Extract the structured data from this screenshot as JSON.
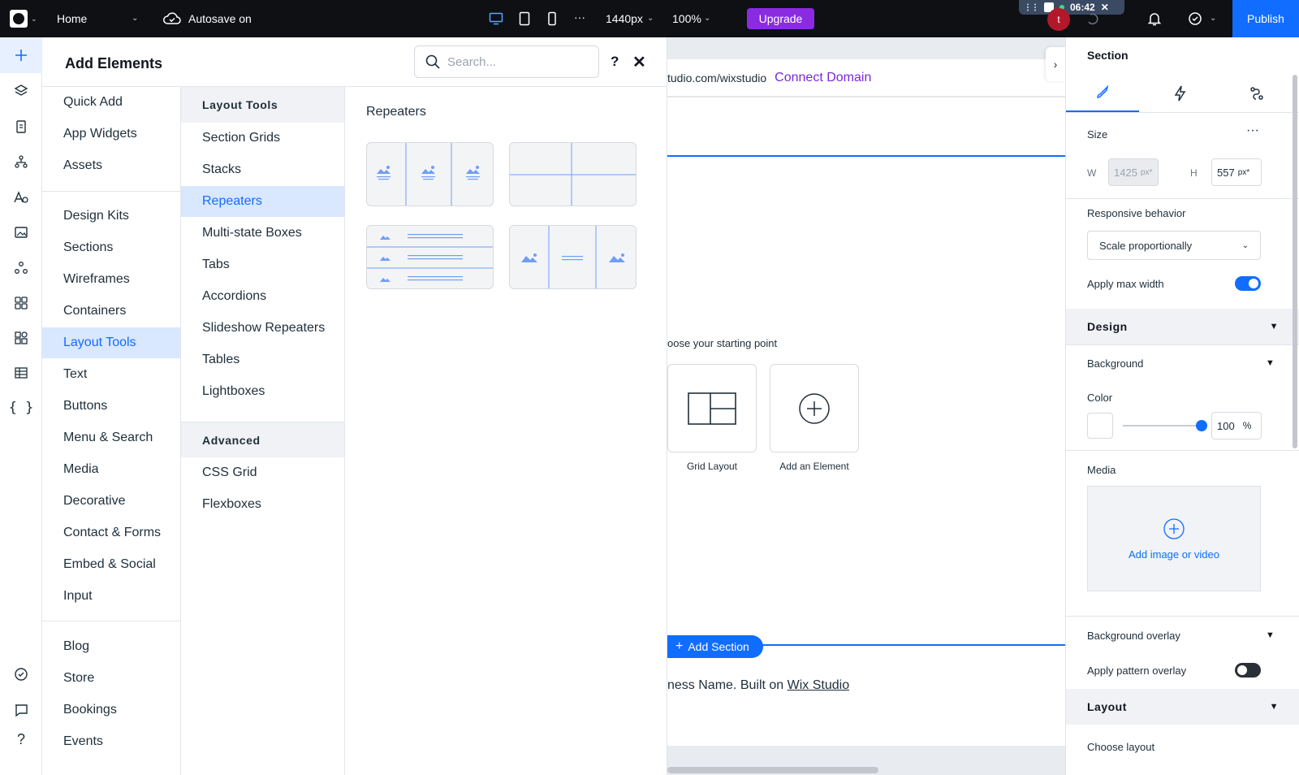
{
  "topbar": {
    "page_name": "Home",
    "autosave": "Autosave on",
    "breakpoint": "1440px",
    "zoom": "100%",
    "more": "···",
    "upgrade": "Upgrade",
    "avatar_letter": "t",
    "publish": "Publish",
    "recorder": {
      "time": "06:42"
    },
    "colors": {
      "upgrade": "#8a2be2",
      "publish": "#116dff",
      "bar": "#0e1014"
    }
  },
  "rail": {
    "items": [
      "add-icon",
      "layers-icon",
      "pages-icon",
      "site-structure-icon",
      "text-theme-icon",
      "media-icon",
      "apps-icon",
      "widgets-icon",
      "cms-icon",
      "table-icon",
      "code-icon",
      "checklist-icon",
      "chat-icon",
      "help-icon"
    ]
  },
  "panel": {
    "title": "Add Elements",
    "search_placeholder": "Search...",
    "help": "?",
    "categories_group1": [
      "Quick Add",
      "App Widgets",
      "Assets"
    ],
    "categories_group2": [
      "Design Kits",
      "Sections",
      "Wireframes",
      "Containers",
      "Layout Tools",
      "Text",
      "Buttons",
      "Menu & Search",
      "Media",
      "Decorative",
      "Contact & Forms",
      "Embed & Social",
      "Input"
    ],
    "categories_group3": [
      "Blog",
      "Store",
      "Bookings",
      "Events"
    ],
    "active_category": "Layout Tools",
    "subsections": [
      {
        "heading": "Layout Tools",
        "items": [
          "Section Grids",
          "Stacks",
          "Repeaters",
          "Multi-state Boxes",
          "Tabs",
          "Accordions",
          "Slideshow Repeaters",
          "Tables",
          "Lightboxes"
        ]
      },
      {
        "heading": "Advanced",
        "items": [
          "CSS Grid",
          "Flexboxes"
        ]
      }
    ],
    "active_subsection": "Repeaters",
    "content_heading": "Repeaters"
  },
  "canvas": {
    "url_text": "tudio.com/wixstudio",
    "connect_domain": "Connect Domain",
    "starting_point": "oose your starting point",
    "cards": [
      {
        "label": "Grid Layout",
        "icon": "grid-layout-icon"
      },
      {
        "label": "Add an Element",
        "icon": "add-circle-icon"
      }
    ],
    "add_section": "Add Section",
    "footer_prefix": "ness Name. Built on ",
    "footer_link": "Wix Studio"
  },
  "inspector": {
    "title": "Section",
    "tabs": [
      "design-brush-icon",
      "interactions-bolt-icon",
      "connect-icon"
    ],
    "size_label": "Size",
    "width_label": "W",
    "width_value": "1425",
    "width_unit": "px*",
    "height_label": "H",
    "height_value": "557",
    "height_unit": "px*",
    "responsive_label": "Responsive behavior",
    "responsive_value": "Scale proportionally",
    "max_width_label": "Apply max width",
    "max_width_on": true,
    "design_heading": "Design",
    "background_label": "Background",
    "color_label": "Color",
    "opacity_value": "100",
    "opacity_unit": "%",
    "media_label": "Media",
    "media_add": "Add image or video",
    "overlay_label": "Background overlay",
    "pattern_label": "Apply pattern overlay",
    "pattern_on": false,
    "layout_heading": "Layout",
    "choose_layout": "Choose layout"
  }
}
